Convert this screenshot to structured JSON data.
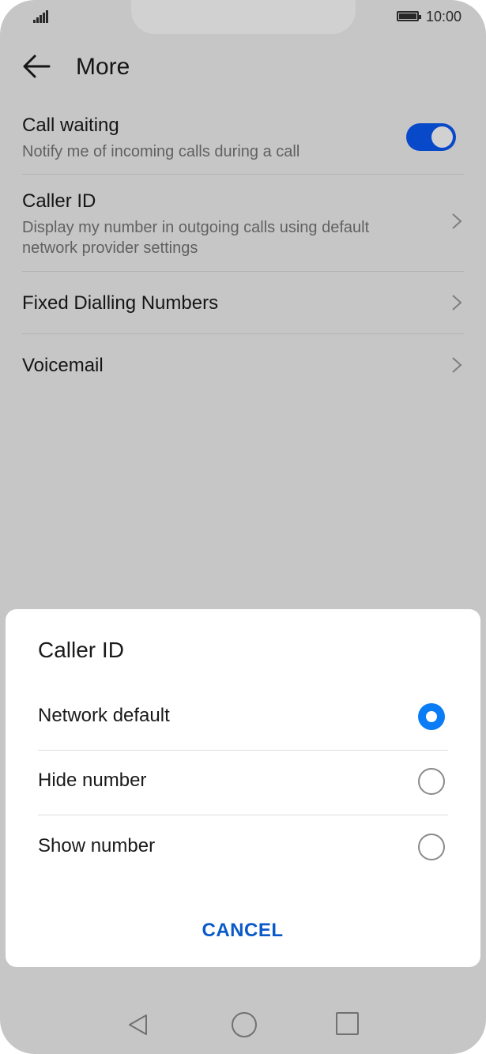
{
  "status_bar": {
    "time": "10:00"
  },
  "header": {
    "title": "More"
  },
  "settings": {
    "call_waiting": {
      "title": "Call waiting",
      "subtitle": "Notify me of incoming calls during a call",
      "enabled": true
    },
    "caller_id": {
      "title": "Caller ID",
      "subtitle": "Display my number in outgoing calls using default network provider settings"
    },
    "fixed_dialling": {
      "title": "Fixed Dialling Numbers"
    },
    "voicemail": {
      "title": "Voicemail"
    }
  },
  "dialog": {
    "title": "Caller ID",
    "options": [
      {
        "label": "Network default",
        "selected": true
      },
      {
        "label": "Hide number",
        "selected": false
      },
      {
        "label": "Show number",
        "selected": false
      }
    ],
    "cancel_label": "CANCEL"
  },
  "colors": {
    "accent": "#0a59f7",
    "radio_selected": "#0a7cf5",
    "button_text": "#0a59c8"
  }
}
